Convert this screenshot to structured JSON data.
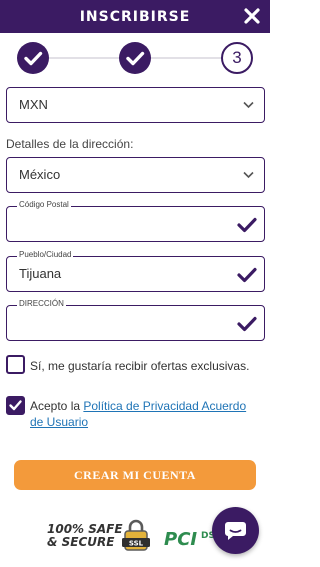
{
  "header": {
    "title": "INSCRIBIRSE"
  },
  "stepper": {
    "current_step": "3",
    "steps_completed": 2,
    "total_steps": 3
  },
  "currency": {
    "selected": "MXN"
  },
  "address": {
    "section_label": "Detalles de la dirección:",
    "country": "México",
    "postal_code_label": "Código Postal",
    "postal_code_value": "",
    "city_label": "Pueblo/Ciudad",
    "city_value": "Tijuana",
    "address_label": "DIRECCIÓN",
    "address_value": ""
  },
  "offers_checkbox": {
    "label": "Sí, me gustaría recibir ofertas exclusivas.",
    "checked": false
  },
  "terms_checkbox": {
    "prefix": "Acepto la ",
    "link_text": "Política de Privacidad Acuerdo de Usuario",
    "checked": true
  },
  "submit_button": {
    "label": "CREAR MI CUENTA"
  },
  "trust_badges": {
    "safe_line1": "100% SAFE",
    "safe_line2": "& SECURE",
    "ssl": "SSL",
    "pci": "PCI",
    "dss": "DSS"
  },
  "colors": {
    "primary": "#3b1b63",
    "accent": "#f39a3b",
    "link": "#1f74b6"
  },
  "icons": [
    "close-icon",
    "check-icon",
    "chevron-down-icon",
    "lock-icon",
    "chat-icon"
  ]
}
